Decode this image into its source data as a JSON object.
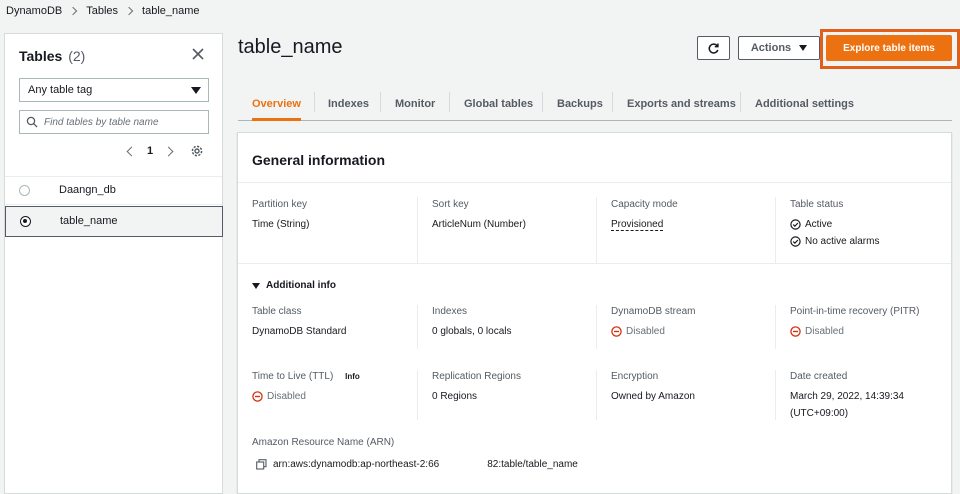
{
  "breadcrumb": [
    "DynamoDB",
    "Tables",
    "table_name"
  ],
  "left_panel": {
    "title": "Tables",
    "count": "(2)",
    "tag_filter": "Any table tag",
    "search_placeholder": "Find tables by table name",
    "page": "1",
    "tables": [
      {
        "name": "Daangn_db",
        "selected": false
      },
      {
        "name": "table_name",
        "selected": true
      }
    ]
  },
  "header": {
    "title": "table_name",
    "actions_label": "Actions",
    "explore_label": "Explore table items"
  },
  "tabs": [
    "Overview",
    "Indexes",
    "Monitor",
    "Global tables",
    "Backups",
    "Exports and streams",
    "Additional settings"
  ],
  "active_tab": "Overview",
  "general": {
    "title": "General information",
    "partition_key_label": "Partition key",
    "partition_key": "Time (String)",
    "sort_key_label": "Sort key",
    "sort_key": "ArticleNum (Number)",
    "capacity_label": "Capacity mode",
    "capacity": "Provisioned",
    "status_label": "Table status",
    "status": "Active",
    "alarms": "No active alarms"
  },
  "additional": {
    "toggle": "Additional info",
    "table_class_label": "Table class",
    "table_class": "DynamoDB Standard",
    "indexes_label": "Indexes",
    "indexes": "0 globals, 0 locals",
    "stream_label": "DynamoDB stream",
    "stream": "Disabled",
    "pitr_label": "Point-in-time recovery (PITR)",
    "pitr": "Disabled",
    "ttl_label": "Time to Live (TTL)",
    "ttl_info": "Info",
    "ttl": "Disabled",
    "replication_label": "Replication Regions",
    "replication": "0 Regions",
    "encryption_label": "Encryption",
    "encryption": "Owned by Amazon",
    "date_label": "Date created",
    "date_line1": "March 29, 2022, 14:39:34",
    "date_line2": "(UTC+09:00)",
    "arn_label": "Amazon Resource Name (ARN)",
    "arn_part1": "arn:aws:dynamodb:ap-northeast-2:66",
    "arn_part2": "82:table/table_name"
  },
  "colors": {
    "accent": "#ec7211",
    "success": "#1d8102",
    "error": "#d13212"
  }
}
